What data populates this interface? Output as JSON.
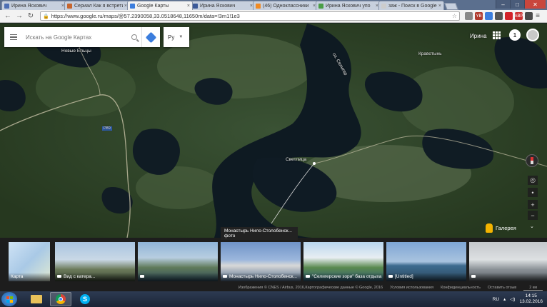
{
  "browser": {
    "tabs": [
      {
        "label": "Ирина Яскович",
        "color": "#4d6fb4"
      },
      {
        "label": "Сериал Как я встретил",
        "color": "#c7662e"
      },
      {
        "label": "Google Карты",
        "color": "#3b7ddd",
        "active": true
      },
      {
        "label": "Ирина Яскович",
        "color": "#3b5998"
      },
      {
        "label": "(46) Одноклассники",
        "color": "#f08a24"
      },
      {
        "label": "Ирина Яскович упо",
        "color": "#4b9e47"
      },
      {
        "label": "заж - Поиск в Google",
        "color": "#cccccc"
      }
    ],
    "url": "https://www.google.ru/maps/@57.2390058,33.0518648,11650m/data=!3m1!1e3",
    "extensions": [
      {
        "color": "#888888",
        "label": ""
      },
      {
        "color": "#b03a2e",
        "label": "YB"
      },
      {
        "color": "#3b7ddd",
        "label": ""
      },
      {
        "color": "#555555",
        "label": ""
      },
      {
        "color": "#d2232a",
        "label": ""
      },
      {
        "color": "#cc3333",
        "label": "ABP"
      },
      {
        "color": "#4a4a4a",
        "label": ""
      }
    ]
  },
  "search": {
    "placeholder": "Искать на Google Картах"
  },
  "language": {
    "value": "Ру"
  },
  "account": {
    "name": "Ирина",
    "notifications": "1"
  },
  "map": {
    "labels": [
      {
        "id": "novye-eltsy",
        "text": "Новые Ельцы"
      },
      {
        "id": "svetlitsa",
        "text": "Светлица"
      },
      {
        "id": "kravotyn",
        "text": "Кравотынь"
      },
      {
        "id": "seliger-lake",
        "text": "оз. Селигер"
      },
      {
        "id": "road-r89",
        "text": "Р89"
      }
    ]
  },
  "gallery": {
    "label": "Галерея",
    "tooltip_title": "Монастырь Нило-Столобенск...",
    "tooltip_sub": "фото",
    "thumbnails": [
      {
        "caption": "Карта",
        "type": "map"
      },
      {
        "caption": "Вид с катера...",
        "type": "photo"
      },
      {
        "caption": "",
        "type": "photo"
      },
      {
        "caption": "Монастырь Нило-Столобенск...",
        "type": "photo"
      },
      {
        "caption": "\"Селигерские зори\" база отдыха",
        "type": "photo"
      },
      {
        "caption": "[Untitled]",
        "type": "photo"
      },
      {
        "caption": "",
        "type": "photo"
      }
    ]
  },
  "footer": {
    "imagery": "Изображения © CNES / Airbus, 2016,Картографические данные © Google, 2016",
    "terms": "Условия использования",
    "privacy": "Конфиденциальность",
    "feedback": "Оставить отзыв",
    "scale": "2 км"
  },
  "taskbar": {
    "lang": "RU",
    "time": "14:15",
    "date": "13.02.2016"
  }
}
